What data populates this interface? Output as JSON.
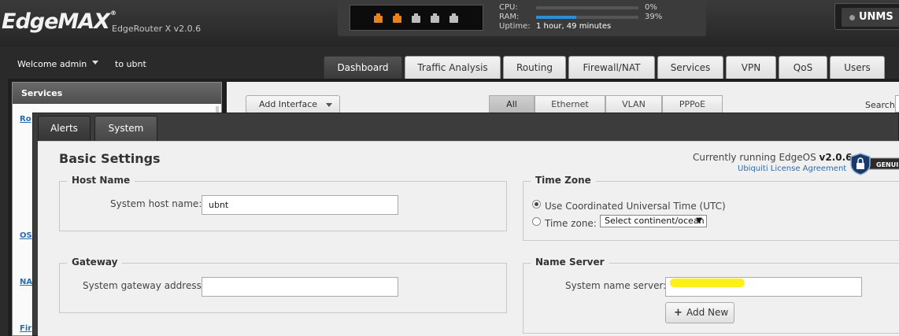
{
  "header": {
    "logo": "EdgeMAX",
    "logo_mark": "®",
    "model": "EdgeRouter X v2.0.6",
    "ports": [
      {
        "status": "active",
        "color": "#e8821e"
      },
      {
        "status": "active",
        "color": "#e8821e"
      },
      {
        "status": "inactive",
        "color": "#bdbdbd"
      },
      {
        "status": "inactive",
        "color": "#bdbdbd"
      },
      {
        "status": "inactive",
        "color": "#bdbdbd"
      }
    ],
    "cpu_label": "CPU:",
    "cpu_value": "0%",
    "cpu_fraction": 0.0,
    "ram_label": "RAM:",
    "ram_value": "39%",
    "ram_fraction": 0.39,
    "uptime_label": "Uptime:",
    "uptime_value": "1 hour, 49 minutes",
    "unms_label": "UNMS"
  },
  "userbar": {
    "welcome": "Welcome admin",
    "to_host": "to ubnt"
  },
  "nav_tabs": [
    {
      "label": "Dashboard",
      "active": true
    },
    {
      "label": "Traffic Analysis",
      "active": false
    },
    {
      "label": "Routing",
      "active": false
    },
    {
      "label": "Firewall/NAT",
      "active": false
    },
    {
      "label": "Services",
      "active": false
    },
    {
      "label": "VPN",
      "active": false
    },
    {
      "label": "QoS",
      "active": false
    },
    {
      "label": "Users",
      "active": false
    }
  ],
  "left_panel": {
    "title": "Services",
    "links": [
      "Ro",
      "OS",
      "NA",
      "Fir"
    ]
  },
  "toolbar": {
    "add_interface": "Add Interface",
    "filters": [
      {
        "label": "All",
        "active": true
      },
      {
        "label": "Ethernet",
        "active": false
      },
      {
        "label": "VLAN",
        "active": false
      },
      {
        "label": "PPPoE",
        "active": false
      }
    ],
    "search_label": "Search"
  },
  "dialog": {
    "tabs": [
      {
        "label": "Alerts",
        "active": false
      },
      {
        "label": "System",
        "active": true
      }
    ],
    "title": "Basic Settings",
    "running_prefix": "Currently running EdgeOS",
    "running_version": "v2.0.6",
    "license_link": "Ubiquiti License Agreement",
    "genuine_badge": "GENUI",
    "host_name": {
      "legend": "Host Name",
      "label": "System host name:",
      "value": "ubnt"
    },
    "gateway": {
      "legend": "Gateway",
      "label": "System gateway address:",
      "value": ""
    },
    "time_zone": {
      "legend": "Time Zone",
      "option_utc": "Use Coordinated Universal Time (UTC)",
      "option_tz": "Time zone:",
      "select_value": "Select continent/ocean",
      "selected": "utc"
    },
    "name_server": {
      "legend": "Name Server",
      "label": "System name server:",
      "value": "",
      "add_new": "Add New"
    }
  }
}
